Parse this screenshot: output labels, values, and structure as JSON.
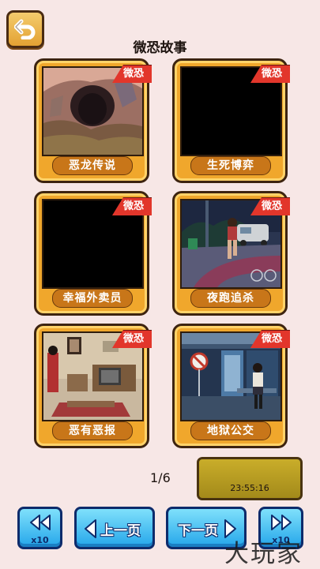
{
  "header": {
    "title": "微恐故事",
    "back_icon": "back-arrow-icon"
  },
  "cards": [
    {
      "title": "恶龙传说",
      "badge": "微恐",
      "image": "cave"
    },
    {
      "title": "生死博弈",
      "badge": "微恐",
      "image": "black"
    },
    {
      "title": "幸福外卖员",
      "badge": "微恐",
      "image": "black"
    },
    {
      "title": "夜跑追杀",
      "badge": "微恐",
      "image": "night-run"
    },
    {
      "title": "恶有恶报",
      "badge": "微恐",
      "image": "room"
    },
    {
      "title": "地狱公交",
      "badge": "微恐",
      "image": "bus-stop"
    }
  ],
  "pager": {
    "page": "1/6",
    "timer": "23:55:16"
  },
  "nav": {
    "prev_label": "上一页",
    "next_label": "下一页",
    "first_label": "x10",
    "last_label": "x10"
  },
  "watermark": "大玩家",
  "colors": {
    "background": "#f7e7e6",
    "card": "#f0a72c",
    "badge": "#e2362b",
    "nav_button": "#24a6ea"
  }
}
